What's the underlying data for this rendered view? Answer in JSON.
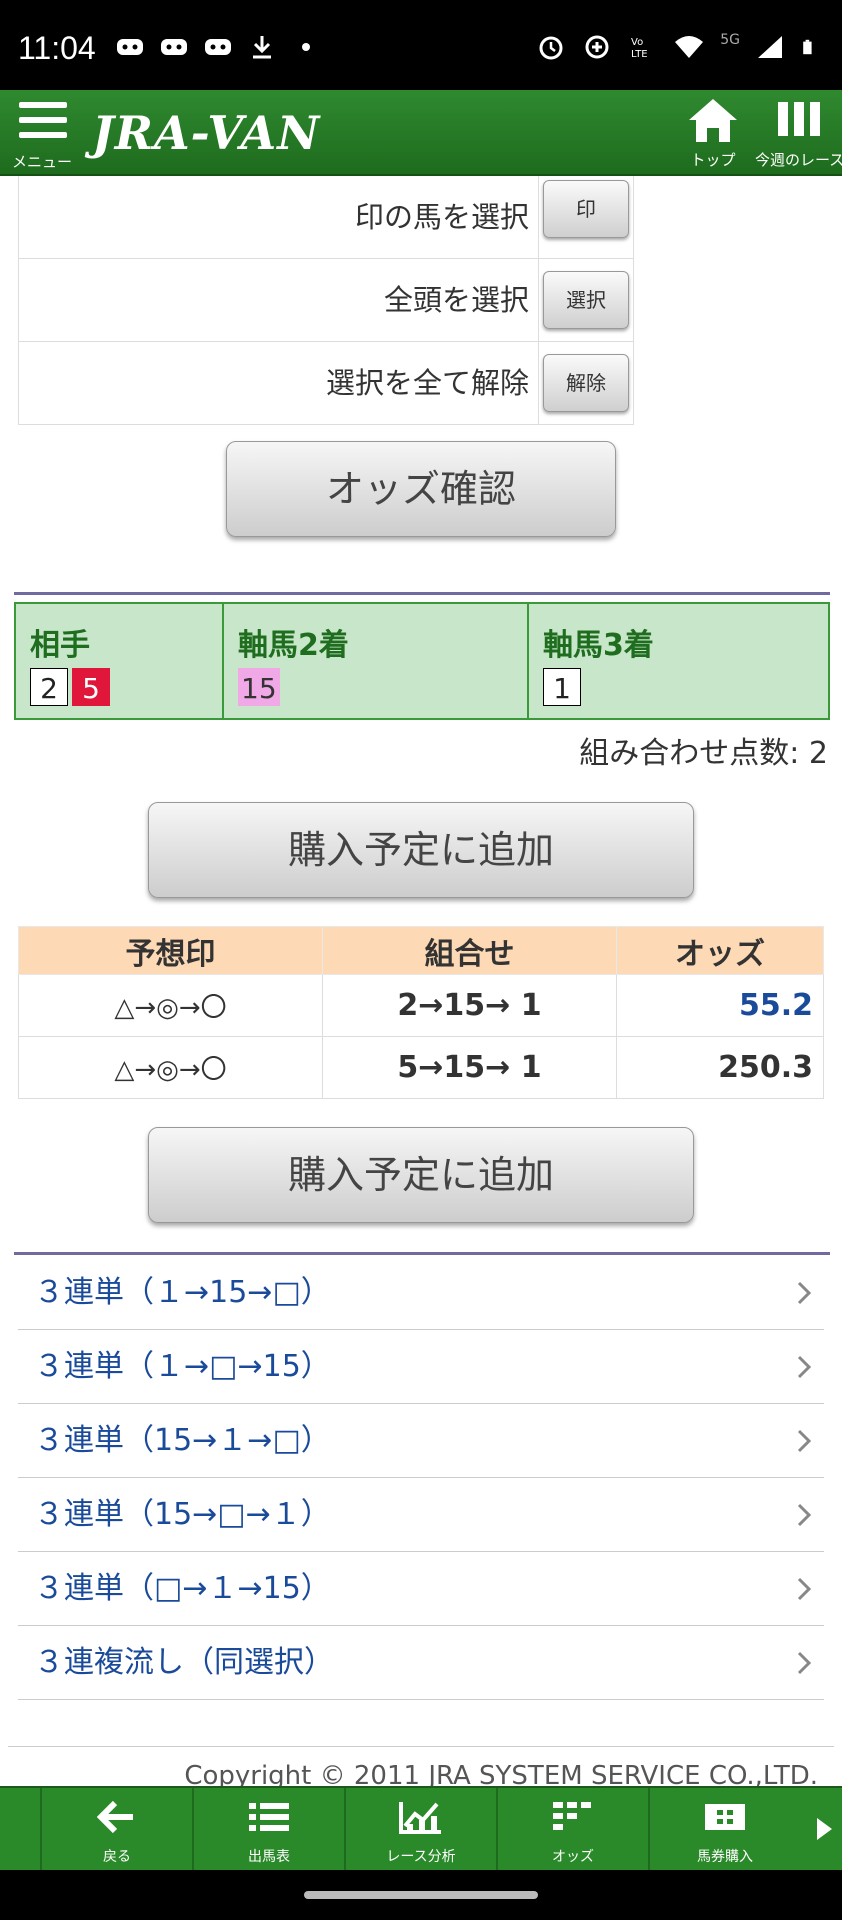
{
  "status_bar": {
    "time": "11:04",
    "network": "5G"
  },
  "header": {
    "menu_label": "メニュー",
    "logo": "JRA-VAN",
    "top_label": "トップ",
    "week_label": "今週のレース"
  },
  "selection_rows": [
    {
      "label": "印の馬を選択",
      "button": "印"
    },
    {
      "label": "全頭を選択",
      "button": "選択"
    },
    {
      "label": "選択を全て解除",
      "button": "解除"
    }
  ],
  "check_odds_button": "オッズ確認",
  "combination": {
    "columns": [
      {
        "header": "相手",
        "horses": [
          "2",
          "5"
        ]
      },
      {
        "header": "軸馬2着",
        "horses": [
          "15"
        ]
      },
      {
        "header": "軸馬3着",
        "horses": [
          "1"
        ]
      }
    ],
    "points_text": "組み合わせ点数: 2"
  },
  "add_button_label": "購入予定に追加",
  "odds_table": {
    "headers": [
      "予想印",
      "組合せ",
      "オッズ"
    ],
    "rows": [
      {
        "mark": "△→◎→〇",
        "combo": "2→15→ 1",
        "odds": "55.2"
      },
      {
        "mark": "△→◎→〇",
        "combo": "5→15→ 1",
        "odds": "250.3"
      }
    ]
  },
  "links": [
    "３連単（１→15→□）",
    "３連単（１→□→15）",
    "３連単（15→１→□）",
    "３連単（15→□→１）",
    "３連単（□→１→15）",
    "３連複流し（同選択）"
  ],
  "copyright": "Copyright © 2011 JRA SYSTEM SERVICE CO.,LTD.",
  "bottom_nav": [
    {
      "label": "戻る",
      "icon": "back-arrow-icon"
    },
    {
      "label": "出馬表",
      "icon": "list-icon"
    },
    {
      "label": "レース分析",
      "icon": "chart-icon"
    },
    {
      "label": "オッズ",
      "icon": "odds-grid-icon"
    },
    {
      "label": "馬券購入",
      "icon": "ticket-icon"
    }
  ],
  "colors": {
    "brand_green": "#2a8a2a",
    "combo_bg": "#c8e6c9",
    "table_header": "#fdd9b5",
    "link_blue": "#1a4a9a",
    "horse_red": "#e0163a",
    "horse_pink": "#f0a8e6"
  }
}
